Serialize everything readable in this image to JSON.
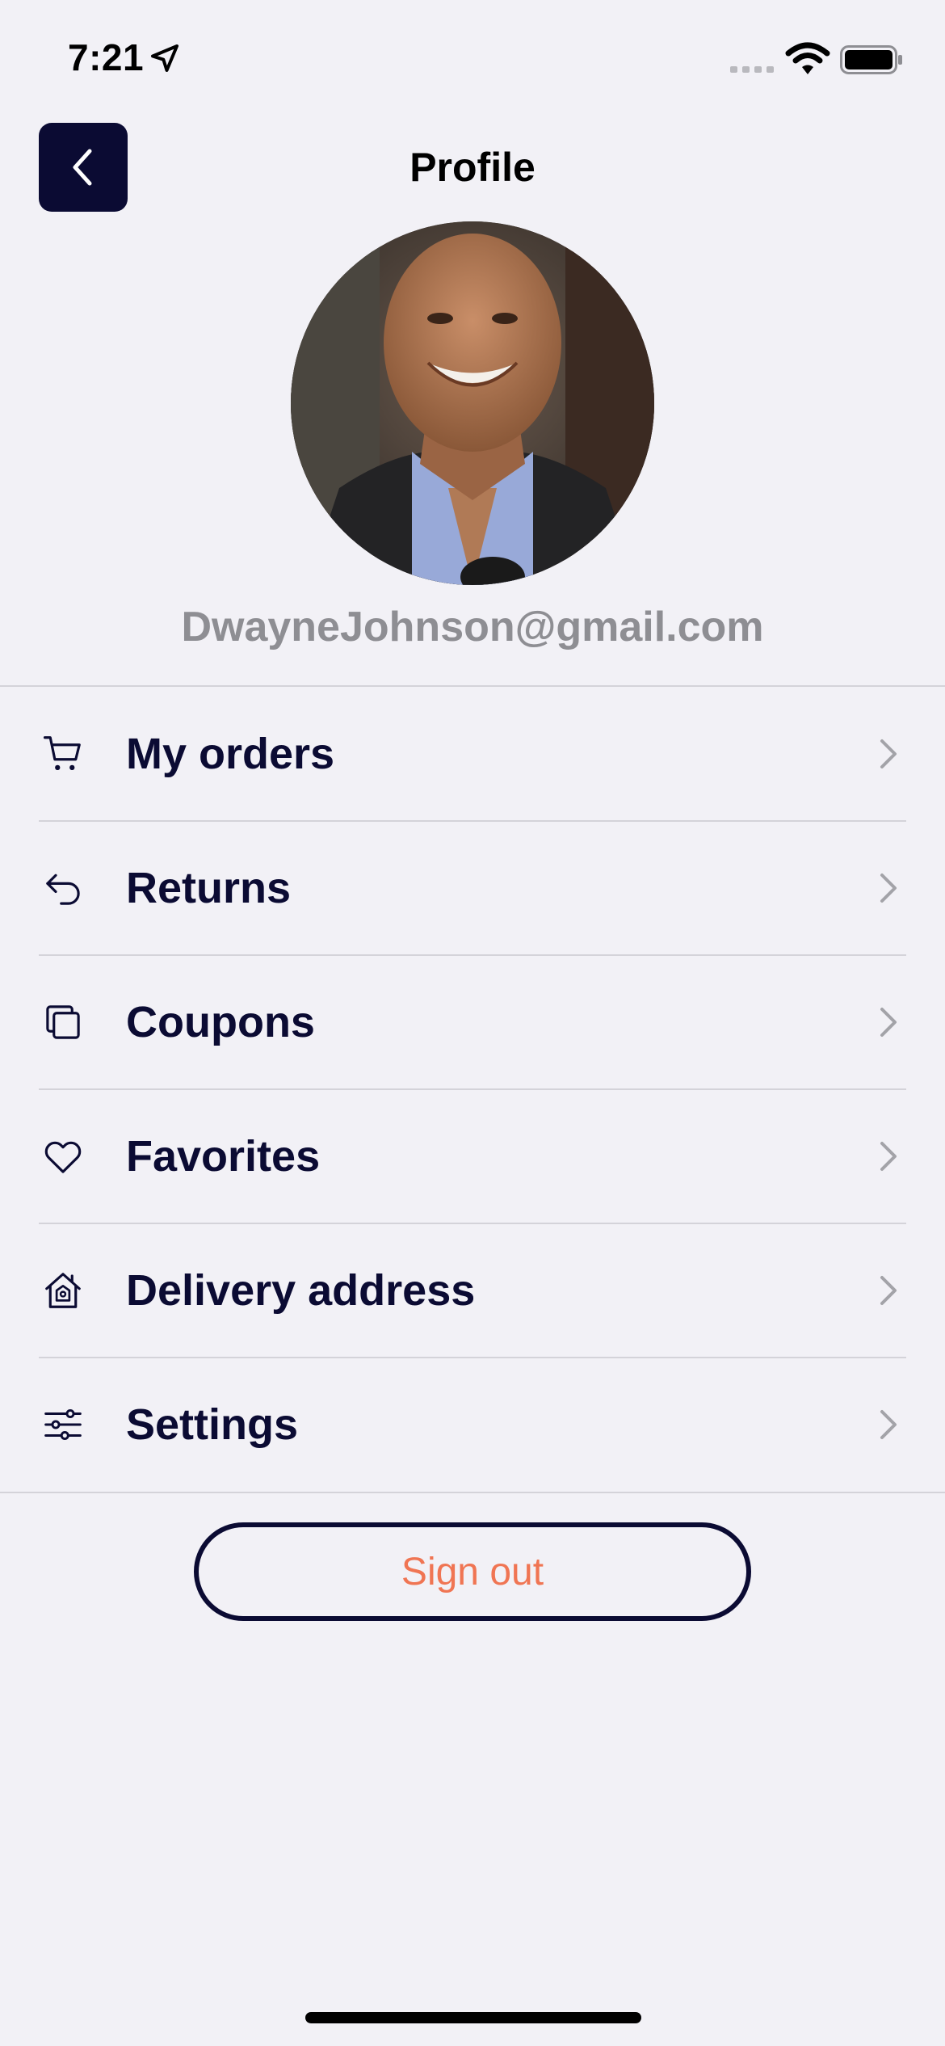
{
  "status_bar": {
    "time": "7:21"
  },
  "header": {
    "title": "Profile"
  },
  "profile": {
    "email": "DwayneJohnson@gmail.com"
  },
  "menu": {
    "items": [
      {
        "label": "My orders",
        "icon": "cart-icon"
      },
      {
        "label": "Returns",
        "icon": "return-arrow-icon"
      },
      {
        "label": "Coupons",
        "icon": "coupons-icon"
      },
      {
        "label": "Favorites",
        "icon": "heart-icon"
      },
      {
        "label": "Delivery address",
        "icon": "home-address-icon"
      },
      {
        "label": "Settings",
        "icon": "sliders-icon"
      }
    ]
  },
  "actions": {
    "sign_out_label": "Sign out"
  },
  "colors": {
    "accent": "#0B0B33",
    "sign_out_text": "#F07553",
    "background": "#F2F1F6"
  }
}
